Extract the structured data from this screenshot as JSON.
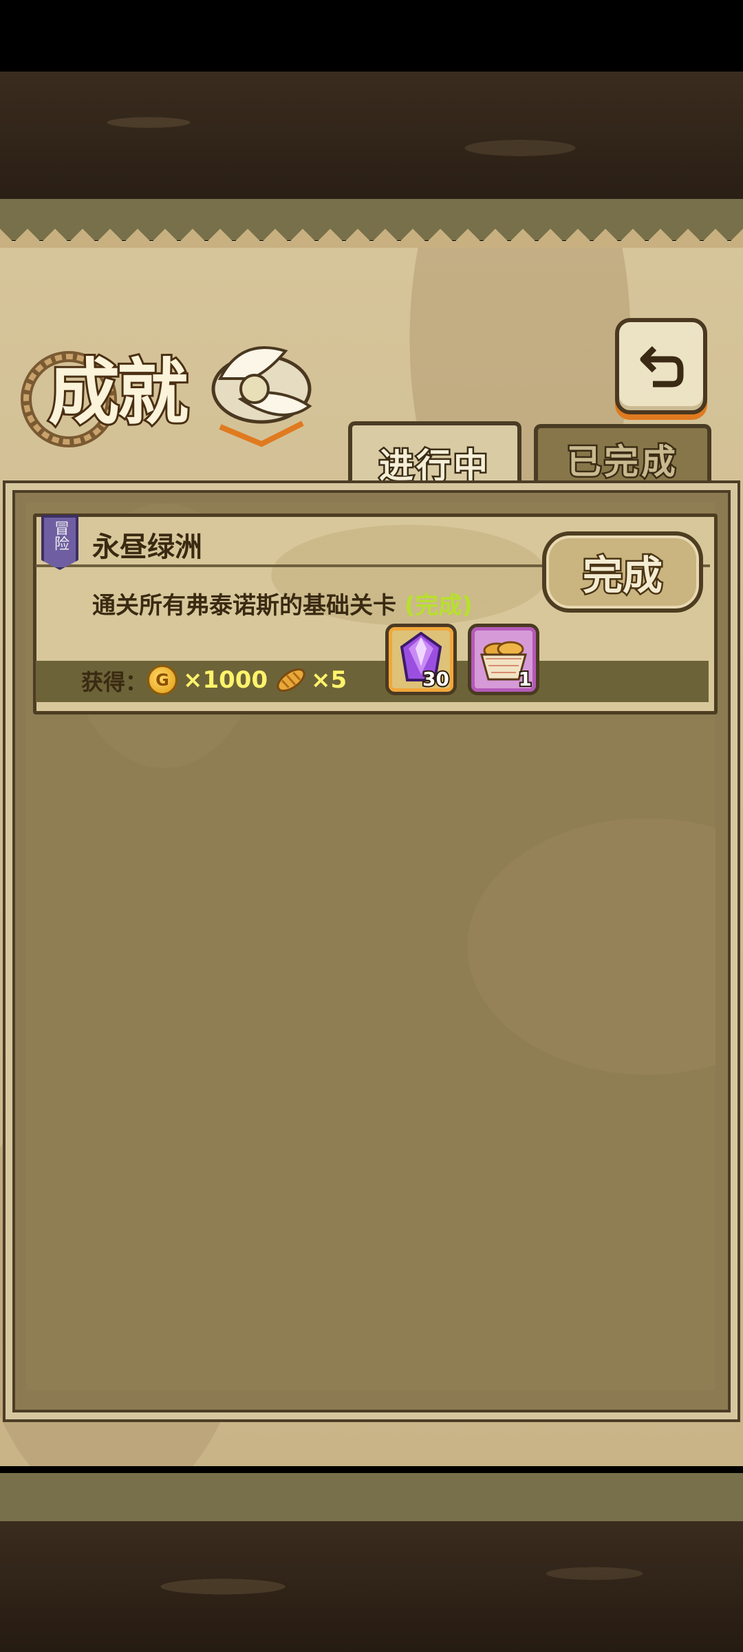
{
  "header": {
    "title": "成就",
    "back_icon": "back-arrow-icon"
  },
  "tabs": [
    {
      "label": "进行中",
      "active": true
    },
    {
      "label": "已完成",
      "active": false
    }
  ],
  "achievements": [
    {
      "category": "冒险",
      "title": "永昼绿洲",
      "description": "通关所有弗泰诺斯的基础关卡",
      "status": "(完成)",
      "button_label": "完成",
      "reward_label": "获得：",
      "rewards": [
        {
          "icon": "gold-coin-icon",
          "coin_letter": "G",
          "amount": "×1000"
        },
        {
          "icon": "bread-icon",
          "amount": "×5"
        }
      ],
      "items": [
        {
          "icon": "purple-crystal-icon",
          "count": "30"
        },
        {
          "icon": "bread-basket-icon",
          "count": "1"
        }
      ]
    }
  ],
  "colors": {
    "status_green": "#b7e12b",
    "reward_yellow": "#fff36b",
    "accent_orange": "#e07a1f"
  }
}
